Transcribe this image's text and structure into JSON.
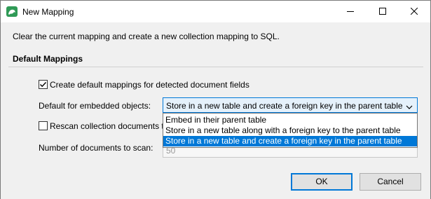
{
  "window": {
    "title": "New Mapping",
    "app_icon": "app-logo-icon",
    "controls": [
      "minimize-icon",
      "maximize-icon",
      "close-icon"
    ]
  },
  "description": "Clear the current mapping and create a new collection mapping to SQL.",
  "section": {
    "title": "Default Mappings"
  },
  "create_defaults": {
    "label": "Create default mappings for detected document fields",
    "checked": true
  },
  "embedded": {
    "label": "Default for embedded objects:",
    "selected": "Store in a new table and create a foreign key in the parent table",
    "options": [
      "Embed in their parent table",
      "Store in a new table along with a foreign key to the parent table",
      "Store in a new table and create a foreign key in the parent table"
    ]
  },
  "rescan": {
    "label": "Rescan collection documents t",
    "checked": false
  },
  "docs_to_scan": {
    "label": "Number of documents to scan:",
    "value": "50"
  },
  "buttons": {
    "ok": "OK",
    "cancel": "Cancel"
  },
  "colors": {
    "accent": "#0078d7",
    "app_icon": "#2f9a56"
  }
}
